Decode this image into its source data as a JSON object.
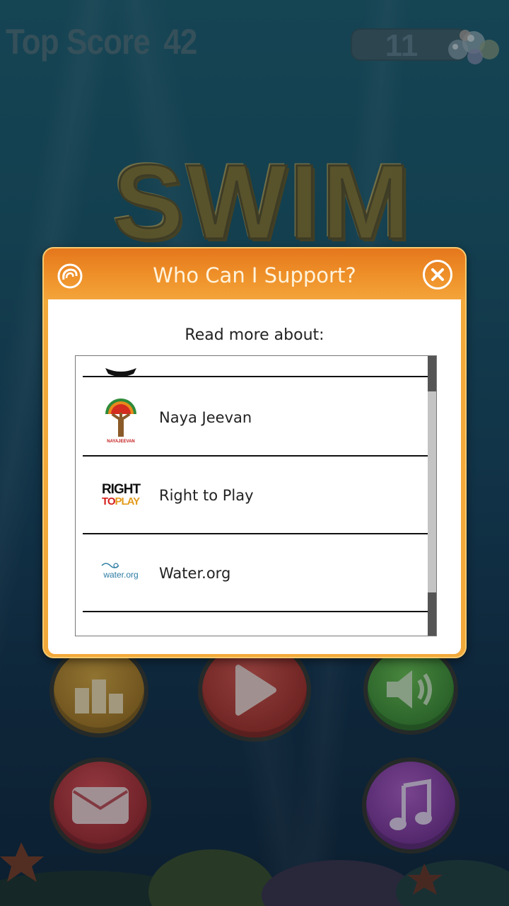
{
  "game": {
    "top_score_label": "Top Score",
    "top_score_value": "42",
    "bubble_count": "11",
    "title": "SWIM"
  },
  "modal": {
    "title": "Who Can I Support?",
    "subtitle": "Read more about:",
    "items": [
      {
        "name": "",
        "logo": "partial-logo"
      },
      {
        "name": "Naya Jeevan",
        "logo": "naya-jeevan-logo"
      },
      {
        "name": "Right to Play",
        "logo": "right-to-play-logo"
      },
      {
        "name": "Water.org",
        "logo": "water-org-logo"
      },
      {
        "name": "",
        "logo": "partial-logo"
      }
    ],
    "logos": {
      "naya_jeevan_text": "NAYAJEEVAN",
      "rtp_line1": "RIGHT",
      "rtp_to": "TO",
      "rtp_play": "PLAY",
      "water_text": "water.org"
    }
  },
  "colors": {
    "modal_orange": "#f2a93a",
    "header_orange": "#e5761c",
    "water_blue": "#1d5b6e"
  }
}
